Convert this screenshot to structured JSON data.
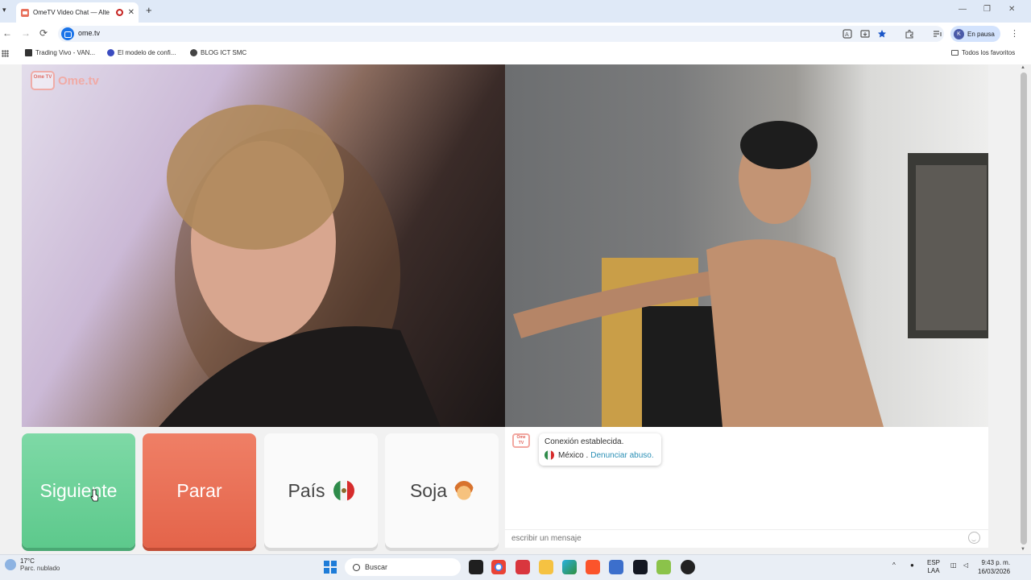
{
  "browser": {
    "tab_title": "OmeTV Video Chat — Alte",
    "tab_close": "✕",
    "new_tab": "+",
    "url": "ome.tv",
    "profile_initial": "K",
    "profile_status": "En pausa",
    "window_min": "—",
    "window_max": "❐",
    "window_close": "✕",
    "back": "←",
    "forward": "→",
    "reload": "⟳",
    "kebab": "⋮",
    "bookmarks": [
      {
        "label": "Trading Vivo - VAN...",
        "color": "#333333"
      },
      {
        "label": "El modelo de confi...",
        "color": "#3b4cc0"
      },
      {
        "label": "BLOG ICT SMC",
        "color": "#444444"
      }
    ],
    "all_bookmarks": "Todos los favoritos"
  },
  "app": {
    "logo_box": "Ome TV",
    "logo_text": "Ome.tv",
    "buttons": {
      "next": "Siguiente",
      "stop": "Parar",
      "country": "País",
      "gender": "Soja"
    },
    "chat": {
      "logo_box": "Ome TV",
      "system_message": "Conexión establecida.",
      "country": "México .",
      "report_link": "Denunciar abuso.",
      "input_placeholder": "escribir un mensaje"
    },
    "colors": {
      "next": "#6ad298",
      "stop": "#e86f55",
      "report_link": "#2a8fb5"
    }
  },
  "taskbar": {
    "temperature": "17°C",
    "weather": "Parc. nublado",
    "search_label": "Buscar",
    "lang_line1": "ESP",
    "lang_line2": "LAA",
    "time": "9:43 p. m.",
    "date": "16/03/2026"
  }
}
